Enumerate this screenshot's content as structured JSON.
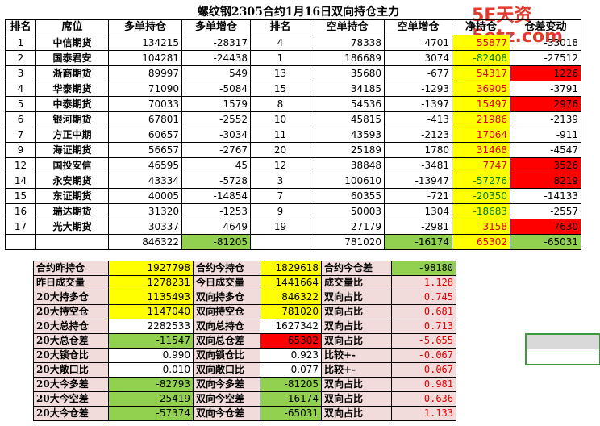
{
  "title": "螺纹钢2305合约1月16日双向持仓主力",
  "watermark": "5E天资5etz.com",
  "headers": [
    "排名",
    "席位",
    "多单持仓",
    "多单增仓",
    "排名",
    "空单持仓",
    "空单增仓",
    "净持仓",
    "仓差变动"
  ],
  "rows": [
    {
      "rank": "1",
      "seat": "中信期货",
      "long": "134215",
      "long_chg": "-28317",
      "srank": "4",
      "short": "78338",
      "short_chg": "4701",
      "net": "55877",
      "diff": "-33018",
      "net_color": "yellow",
      "diff_color": "white"
    },
    {
      "rank": "2",
      "seat": "国泰君安",
      "long": "104281",
      "long_chg": "-24438",
      "srank": "1",
      "short": "186689",
      "short_chg": "3074",
      "net": "-82408",
      "diff": "-27512",
      "net_color": "yellow",
      "diff_color": "white"
    },
    {
      "rank": "3",
      "seat": "浙商期货",
      "long": "89997",
      "long_chg": "549",
      "srank": "13",
      "short": "35680",
      "short_chg": "-677",
      "net": "54317",
      "diff": "1226",
      "net_color": "yellow",
      "diff_color": "red"
    },
    {
      "rank": "4",
      "seat": "华泰期货",
      "long": "71090",
      "long_chg": "-5084",
      "srank": "15",
      "short": "34185",
      "short_chg": "-1293",
      "net": "36905",
      "diff": "-3791",
      "net_color": "yellow",
      "diff_color": "white"
    },
    {
      "rank": "5",
      "seat": "中泰期货",
      "long": "70033",
      "long_chg": "1579",
      "srank": "8",
      "short": "54536",
      "short_chg": "-1397",
      "net": "15497",
      "diff": "2976",
      "net_color": "yellow",
      "diff_color": "red"
    },
    {
      "rank": "6",
      "seat": "银河期货",
      "long": "67801",
      "long_chg": "-2552",
      "srank": "10",
      "short": "45815",
      "short_chg": "-413",
      "net": "21986",
      "diff": "-2139",
      "net_color": "yellow",
      "diff_color": "white"
    },
    {
      "rank": "7",
      "seat": "方正中期",
      "long": "60657",
      "long_chg": "-3034",
      "srank": "11",
      "short": "43593",
      "short_chg": "-2123",
      "net": "17064",
      "diff": "-911",
      "net_color": "yellow",
      "diff_color": "white"
    },
    {
      "rank": "9",
      "seat": "海证期货",
      "long": "56657",
      "long_chg": "-2767",
      "srank": "20",
      "short": "25189",
      "short_chg": "1780",
      "net": "31468",
      "diff": "-4547",
      "net_color": "yellow",
      "diff_color": "white"
    },
    {
      "rank": "12",
      "seat": "国投安信",
      "long": "46595",
      "long_chg": "45",
      "srank": "12",
      "short": "38848",
      "short_chg": "-3481",
      "net": "7747",
      "diff": "3526",
      "net_color": "yellow",
      "diff_color": "red"
    },
    {
      "rank": "14",
      "seat": "永安期货",
      "long": "43334",
      "long_chg": "-5728",
      "srank": "3",
      "short": "100610",
      "short_chg": "-13947",
      "net": "-57276",
      "diff": "8219",
      "net_color": "yellow",
      "diff_color": "red"
    },
    {
      "rank": "15",
      "seat": "东证期货",
      "long": "40005",
      "long_chg": "-14854",
      "srank": "7",
      "short": "60355",
      "short_chg": "-721",
      "net": "-20350",
      "diff": "-14133",
      "net_color": "yellow",
      "diff_color": "white"
    },
    {
      "rank": "16",
      "seat": "瑞达期货",
      "long": "31320",
      "long_chg": "-1253",
      "srank": "9",
      "short": "50003",
      "short_chg": "1304",
      "net": "-18683",
      "diff": "-2557",
      "net_color": "yellow",
      "diff_color": "white"
    },
    {
      "rank": "17",
      "seat": "光大期货",
      "long": "30337",
      "long_chg": "4649",
      "srank": "19",
      "short": "27179",
      "short_chg": "-2981",
      "net": "3158",
      "diff": "7630",
      "net_color": "yellow",
      "diff_color": "red"
    }
  ],
  "totals": {
    "long": "846322",
    "long_chg": "-81205",
    "short": "781020",
    "short_chg": "-16174",
    "net": "65302",
    "diff": "-65031"
  },
  "summary": [
    {
      "l1": "合约昨持仓",
      "v1": "1927798",
      "l2": "合约今持仓",
      "v2": "1829618",
      "l3": "合约今仓差",
      "v3": "-98180"
    },
    {
      "l1": "昨日成交量",
      "v1": "1278231",
      "l2": "今日成交量",
      "v2": "1441664",
      "l3": "成交量比",
      "v3": "1.128"
    },
    {
      "l1": "20大持多仓",
      "v1": "1135493",
      "l2": "双向持多仓",
      "v2": "846322",
      "l3": "双向占比",
      "v3": "0.745"
    },
    {
      "l1": "20大持空仓",
      "v1": "1147040",
      "l2": "双向持空仓",
      "v2": "781020",
      "l3": "双向占比",
      "v3": "0.681"
    },
    {
      "l1": "20大总持仓",
      "v1": "2282533",
      "l2": "双向总持仓",
      "v2": "1627342",
      "l3": "双向占比",
      "v3": "0.713"
    },
    {
      "l1": "20大总仓差",
      "v1": "-11547",
      "l2": "双向总仓差",
      "v2": "65302",
      "l3": "双向占比",
      "v3": "-5.655"
    },
    {
      "l1": "20大锁仓比",
      "v1": "0.990",
      "l2": "双向锁仓比",
      "v2": "0.923",
      "l3": "比较+-",
      "v3": "-0.067"
    },
    {
      "l1": "20大敞口比",
      "v1": "0.010",
      "l2": "双向敞口比",
      "v2": "0.077",
      "l3": "比较+-",
      "v3": "0.067"
    },
    {
      "l1": "20大今多差",
      "v1": "-82793",
      "l2": "双向今多差",
      "v2": "-81205",
      "l3": "双向占比",
      "v3": "0.981"
    },
    {
      "l1": "20大今空差",
      "v1": "-25419",
      "l2": "双向今空差",
      "v2": "-16174",
      "l3": "双向占比",
      "v3": "0.636"
    },
    {
      "l1": "20大今仓差",
      "v1": "-57374",
      "l2": "双向今仓差",
      "v2": "-65031",
      "l3": "双向占比",
      "v3": "1.133"
    }
  ],
  "colors": {
    "yellow": "#ffff00",
    "red": "#ff0000",
    "green": "#92d050",
    "pink": "#f2dcdb",
    "accent_text_red": "#e00000"
  }
}
